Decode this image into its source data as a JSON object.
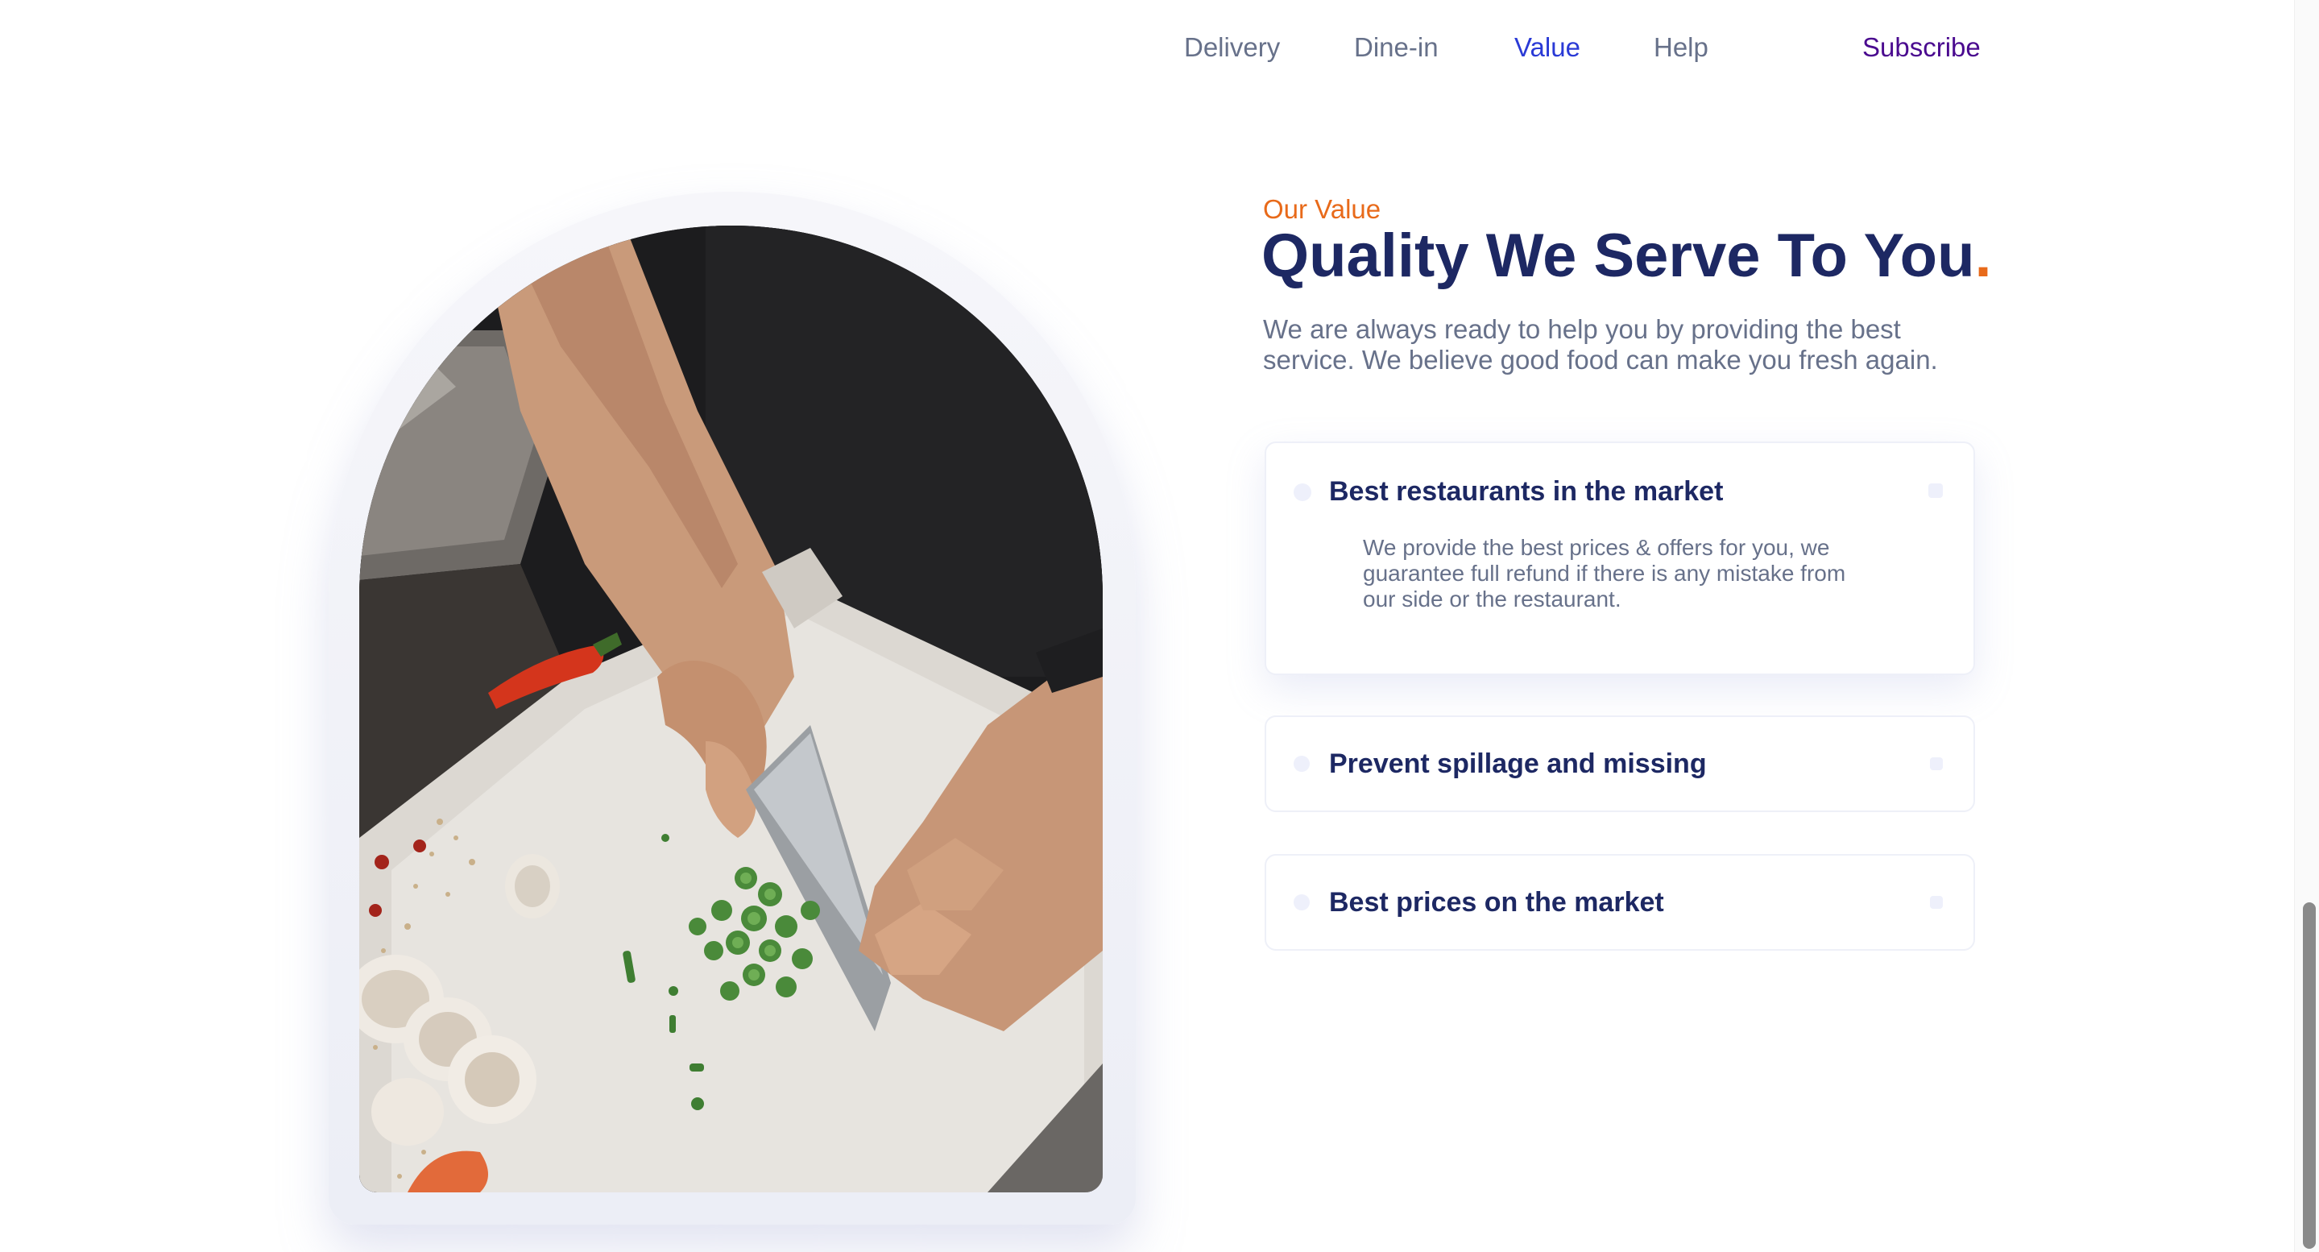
{
  "nav": {
    "items": [
      {
        "label": "Delivery",
        "active": false
      },
      {
        "label": "Dine-in",
        "active": false
      },
      {
        "label": "Value",
        "active": true
      },
      {
        "label": "Help",
        "active": false
      }
    ],
    "subscribe_label": "Subscribe"
  },
  "section": {
    "eyebrow": "Our Value",
    "title": "Quality We Serve To You",
    "title_dot": ".",
    "lead": "We are always ready to help you by providing the best service. We believe good food can make you fresh again."
  },
  "image": {
    "icon": "chef-chopping-vegetables-photo"
  },
  "accordion": {
    "items": [
      {
        "title": "Best restaurants in the market",
        "body": "We provide the best prices & offers for you, we guarantee full refund if there is any mistake from our side or the restaurant.",
        "expanded": true
      },
      {
        "title": "Prevent spillage and missing",
        "expanded": false
      },
      {
        "title": "Best prices on the market",
        "expanded": false
      }
    ]
  },
  "colors": {
    "accent": "#e86a1a",
    "heading": "#1d2863",
    "nav_active": "#2a3ad6",
    "subscribe": "#4a0a8f",
    "muted_text": "#67718a"
  }
}
